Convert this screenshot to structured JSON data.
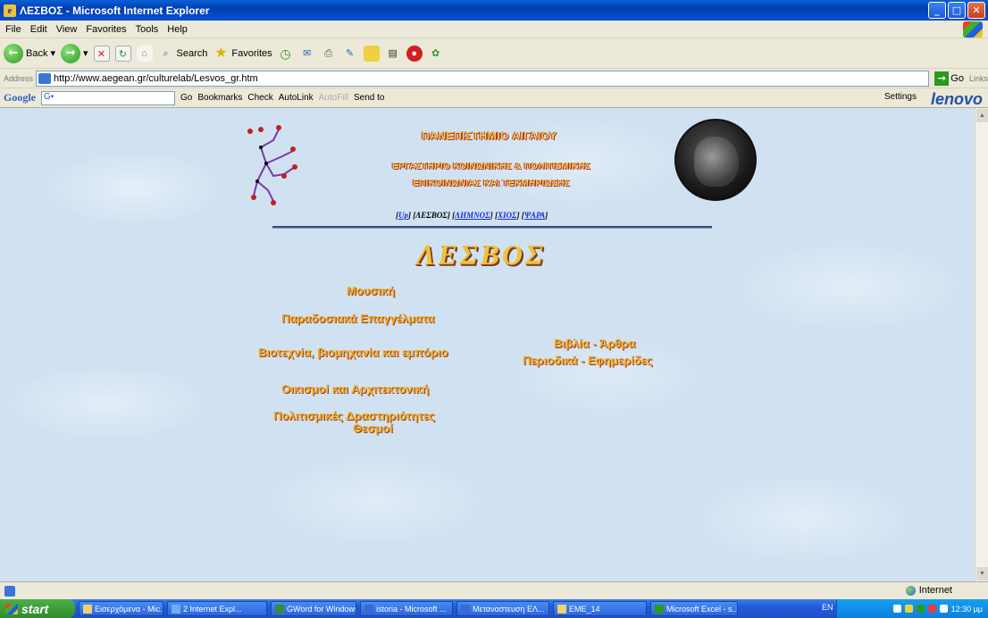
{
  "window": {
    "title": "ΛΕΣΒΟΣ - Microsoft Internet Explorer",
    "buttons": [
      "_",
      "□",
      "✕"
    ]
  },
  "menu": [
    "File",
    "Edit",
    "View",
    "Favorites",
    "Tools",
    "Help"
  ],
  "toolbar": {
    "back": "Back",
    "search": "Search",
    "favorites": "Favorites"
  },
  "address": {
    "label": "Address",
    "url": "http://www.aegean.gr/culturelab/Lesvos_gr.htm",
    "go": "Go",
    "links": "Links"
  },
  "googlebar": {
    "logo": "Google",
    "input": "G•",
    "go": "Go",
    "bookmarks": "Bookmarks",
    "check": "Check",
    "autolink": "AutoLink",
    "autofill": "AutoFill",
    "sendto": "Send to",
    "settings": "Settings",
    "brand": "lenovo"
  },
  "page": {
    "university": "ΠΑΝΕΠΙΣΤΗΜΙΟ ΑΙΓΑΙΟΥ",
    "lab_line1": "ΕΡΓΑΣΤΗΡΙΟ ΚΟΙΝΩΝΙΚΗΣ & ΠΟΛΙΤΙΣΜΙΚΗΣ",
    "lab_line2": "ΕΠΙΚΟΙΝΩΝΙΑΣ ΚΑΙ ΤΕΚΜΗΡΙΩΣΗΣ",
    "nav": {
      "open": "[",
      "up": "Up",
      "sep1": "] [",
      "current": "ΛΕΣΒΟΣ",
      "sep2": "] [",
      "limnos": "ΛΗΜΝΟΣ",
      "sep3": "] [",
      "chios": "ΧΙΟΣ",
      "sep4": "] [",
      "psara": "ΨΑΡΑ",
      "close": "]"
    },
    "heading": "ΛΕΣΒΟΣ",
    "links": {
      "music": "Μουσική",
      "crafts": "Παραδοσιακά Επαγγέλματα",
      "industry": "Βιοτεχνία, βιομηχανία και εμπόριο",
      "books1": "Βιβλία - Άρθρα",
      "books2": "Περιοδικά - Εφημερίδες",
      "settlements": "Οικισμοί και Αρχιτεκτονική",
      "culture1": "Πολιτισμικές Δραστηριότητες",
      "culture2": "Θεσμοί"
    }
  },
  "status": {
    "zone": "Internet"
  },
  "taskbar": {
    "start": "start",
    "tasks": [
      "Εισερχόμενα - Mic...",
      "2 Internet Expl...",
      "GWord for Windows",
      "istoria - Microsoft ...",
      "Μεταναστευση ΕΛ...",
      "EME_14",
      "Microsoft Excel - s..."
    ],
    "lang": "EN",
    "clock": "12:30 μμ"
  }
}
